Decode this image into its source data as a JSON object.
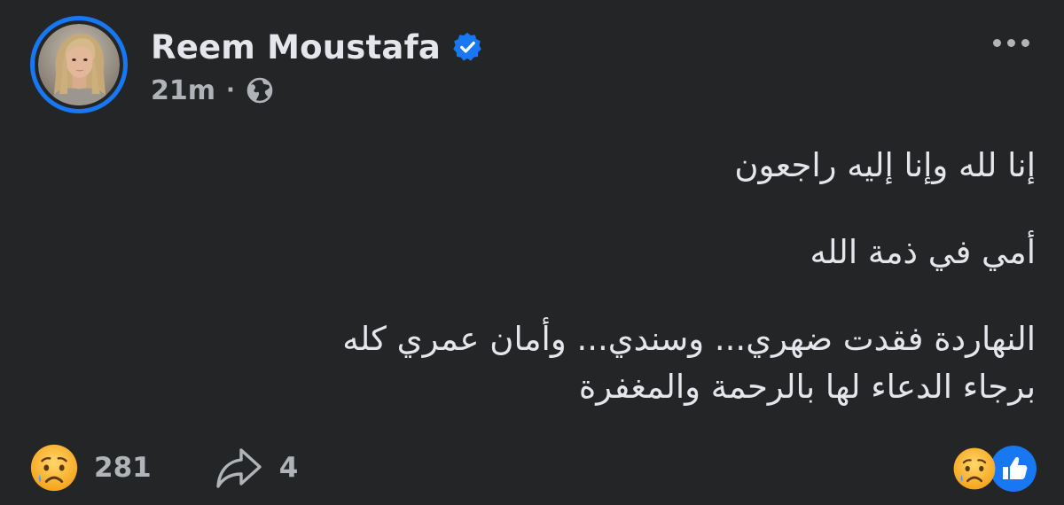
{
  "post": {
    "author": {
      "name": "Reem Moustafa",
      "verified": true,
      "avatar_icon": "profile-photo"
    },
    "meta": {
      "time": "21m",
      "separator": "·",
      "audience_icon": "globe-icon"
    },
    "menu_icon": "more-horizontal-icon",
    "text": {
      "line1": "إنا لله وإنا إليه راجعون",
      "line2": "أمي في ذمة الله",
      "line3": "النهاردة فقدت ضهري... وسندي... وأمان عمري كله",
      "line4": "برجاء الدعاء لها بالرحمة والمغفرة"
    },
    "footer": {
      "reaction_icon": "sad-face-icon",
      "reaction_count": "281",
      "share_icon": "share-arrow-icon",
      "share_count": "4",
      "summary_icons": [
        "sad-face-icon",
        "like-icon"
      ]
    }
  },
  "colors": {
    "background": "#242526",
    "primary_text": "#e4e6eb",
    "secondary_text": "#b0b3b8",
    "accent": "#1877f2",
    "sad_emoji": "#f7b125"
  }
}
